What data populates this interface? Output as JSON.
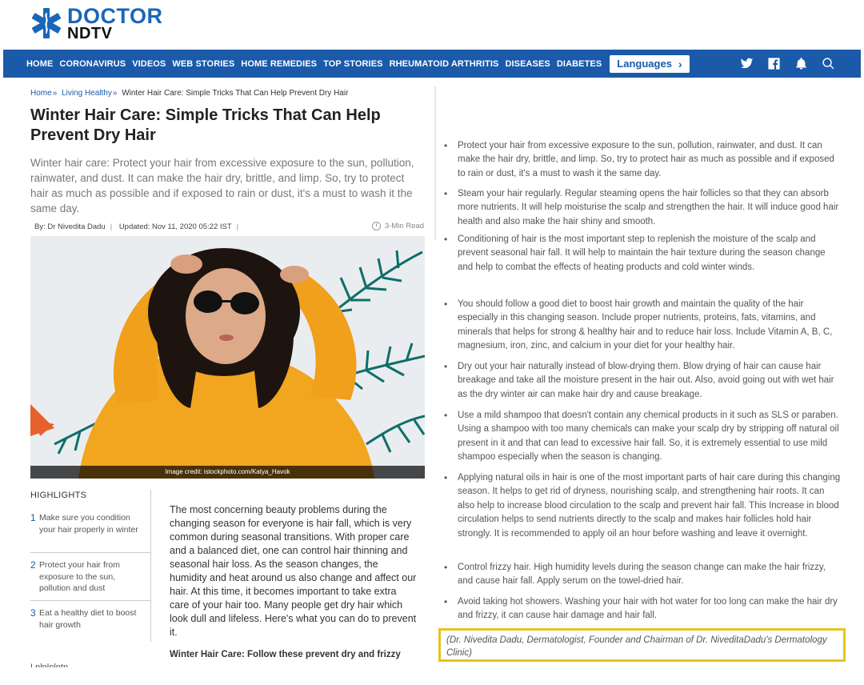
{
  "logo": {
    "top": "DOCTOR",
    "bottom": "NDTV"
  },
  "nav": {
    "items": [
      "HOME",
      "CORONAVIRUS",
      "VIDEOS",
      "WEB STORIES",
      "HOME REMEDIES",
      "TOP STORIES",
      "RHEUMATOID ARTHRITIS",
      "DISEASES",
      "DIABETES"
    ],
    "languages_label": "Languages",
    "icons": [
      "twitter-icon",
      "facebook-icon",
      "bell-icon",
      "search-icon"
    ]
  },
  "breadcrumb": {
    "home": "Home",
    "category": "Living Healthy",
    "current": "Winter Hair Care: Simple Tricks That Can Help Prevent Dry Hair"
  },
  "article": {
    "title": "Winter Hair Care: Simple Tricks That Can Help Prevent Dry Hair",
    "summary": "Winter hair care: Protect your hair from excessive exposure to the sun, pollution, rainwater, and dust. It can make the hair dry, brittle, and limp. So, try to protect hair as much as possible and if exposed to rain or dust, it's a must to wash it the same day.",
    "byline": "By: Dr Nivedita Dadu",
    "updated": "Updated: Nov 11, 2020 05:22 IST",
    "read_time": "3-Min Read",
    "image_credit": "Image credit: istockphoto.com/Katya_Havok",
    "body": "The most concerning beauty problems during the changing season for everyone is hair fall, which is very common during seasonal transitions. With proper care and a balanced diet, one can control hair thinning and seasonal hair loss. As the season changes, the humidity and heat around us also change and affect our hair. At this time, it becomes important to take extra care of your hair too. Many people get dry hair which look dull and lifeless. Here's what you can do to prevent it.",
    "subheading": "Winter Hair Care: Follow these prevent dry and frizzy",
    "cut_off": "Lnlnlnlntn"
  },
  "highlights": {
    "title": "HIGHLIGHTS",
    "items": [
      {
        "num": "1",
        "text": "Make sure you condition your hair properly in winter"
      },
      {
        "num": "2",
        "text": "Protect your hair from exposure to the sun, pollution and dust"
      },
      {
        "num": "3",
        "text": "Eat a healthy diet to boost hair growth"
      }
    ]
  },
  "tips": [
    "Protect your hair from excessive exposure to the sun, pollution, rainwater, and dust. It can make the hair dry, brittle, and limp. So, try to protect hair as much as possible and if exposed to rain or dust, it's a must to wash it the same day.",
    "Steam your hair regularly. Regular steaming opens the hair follicles so that they can absorb more nutrients. It will help moisturise the scalp and strengthen the hair. It will induce good hair health and also make the hair shiny and smooth.",
    "Conditioning of hair is the most important step to replenish the moisture of the scalp and prevent seasonal hair fall. It will help to maintain the hair texture during the season change and help to combat the effects of heating products and cold winter winds.",
    "You should follow a good diet to boost hair growth and maintain the quality of the hair especially in this changing season. Include proper nutrients, proteins, fats, vitamins, and minerals that helps for strong & healthy hair and to reduce hair loss. Include Vitamin A, B, C, magnesium, iron, zinc, and calcium in your diet for your healthy hair.",
    "Dry out your hair naturally instead of blow-drying them. Blow drying of hair can cause hair breakage and take all the moisture present in the hair out. Also, avoid going out with wet hair as the dry winter air can make hair dry and cause breakage.",
    "Use a mild shampoo that doesn't contain any chemical products in it such as SLS or paraben. Using a shampoo with too many chemicals can make your scalp dry by stripping off natural oil present in it and that can lead to excessive hair fall. So, it is extremely essential to use mild shampoo especially when the season is changing.",
    "Applying natural oils in hair is one of the most important parts of hair care during this changing season. It helps to get rid of dryness, nourishing scalp, and strengthening hair roots. It can also help to increase blood circulation to the scalp and prevent hair fall. This Increase in blood circulation helps to send nutrients directly to the scalp and makes hair follicles hold hair strongly. It is recommended to apply oil an hour before washing and leave it overnight.",
    "Control frizzy hair. High humidity levels during the season change can make the hair frizzy, and cause hair fall. Apply serum on the towel-dried hair.",
    "Avoid taking hot showers. Washing your hair with hot water for too long can make the hair dry and frizzy, it can cause hair damage and hair fall."
  ],
  "quote": "(Dr. Nivedita Dadu, Dermatologist, Founder and Chairman of Dr. NiveditaDadu's Dermatology Clinic)",
  "colors": {
    "brand_blue": "#1a5aa8",
    "highlight_border": "#e6c41e",
    "sweater": "#f2a51e"
  }
}
